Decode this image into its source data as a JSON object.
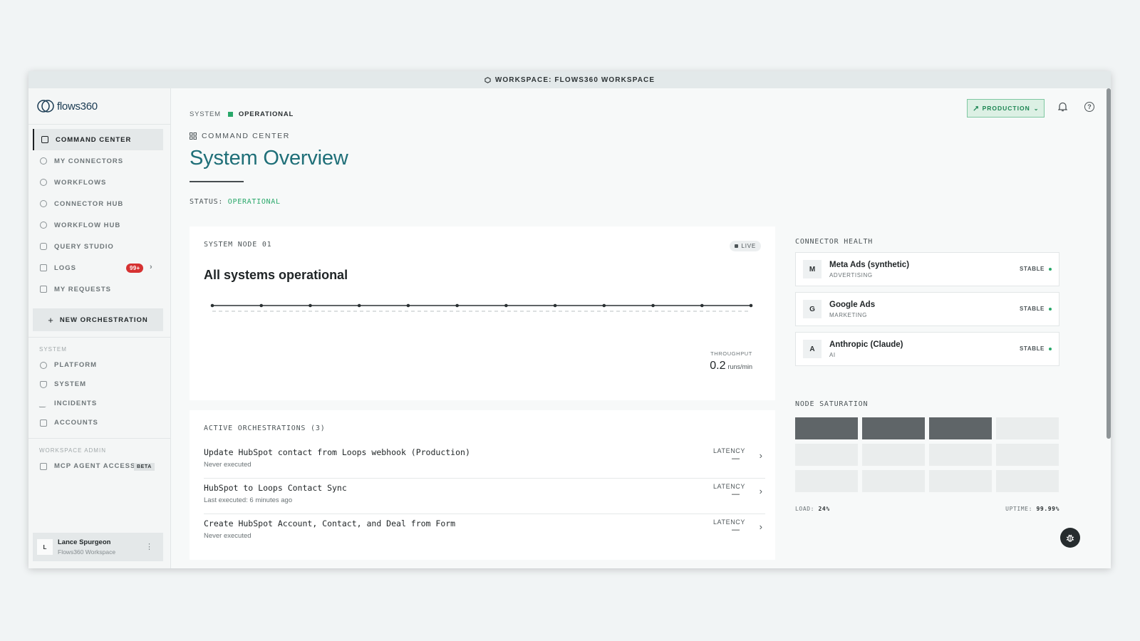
{
  "window": {
    "workspace_label": "WORKSPACE: FLOWS360 WORKSPACE"
  },
  "sidebar": {
    "logo_text": "flows360",
    "items": [
      {
        "label": "COMMAND CENTER",
        "icon": "grid-icon",
        "active": true
      },
      {
        "label": "MY CONNECTORS",
        "icon": "plug-icon"
      },
      {
        "label": "WORKFLOWS",
        "icon": "workflow-icon"
      },
      {
        "label": "CONNECTOR HUB",
        "icon": "hub-icon"
      },
      {
        "label": "WORKFLOW HUB",
        "icon": "workflow-icon"
      },
      {
        "label": "QUERY STUDIO",
        "icon": "database-icon"
      },
      {
        "label": "LOGS",
        "icon": "log-icon",
        "badge": "99+"
      },
      {
        "label": "MY REQUESTS",
        "icon": "inbox-icon"
      }
    ],
    "new_button": "NEW ORCHESTRATION",
    "system_section": "SYSTEM",
    "system_items": [
      {
        "label": "PLATFORM",
        "icon": "globe-icon"
      },
      {
        "label": "SYSTEM",
        "icon": "shield-icon"
      },
      {
        "label": "INCIDENTS",
        "icon": "activity-icon"
      },
      {
        "label": "ACCOUNTS",
        "icon": "building-icon"
      }
    ],
    "admin_section": "WORKSPACE ADMIN",
    "admin_items": [
      {
        "label": "MCP AGENT ACCESS",
        "icon": "robot-icon",
        "badge": "BETA"
      }
    ],
    "user": {
      "initial": "L",
      "name": "Lance Spurgeon",
      "workspace": "Flows360 Workspace"
    }
  },
  "header": {
    "env_button": "PRODUCTION",
    "system_label": "SYSTEM",
    "system_status": "OPERATIONAL",
    "breadcrumb": "COMMAND CENTER",
    "title": "System Overview",
    "status_label": "STATUS:",
    "status_value": "OPERATIONAL"
  },
  "node_card": {
    "label": "SYSTEM NODE 01",
    "live": "LIVE",
    "headline": "All systems operational",
    "throughput_label": "THROUGHPUT",
    "throughput_value": "0.2",
    "throughput_unit": "runs/min"
  },
  "orchestrations": {
    "title": "ACTIVE ORCHESTRATIONS (3)",
    "latency_label": "LATENCY",
    "rows": [
      {
        "name": "Update HubSpot contact from Loops webhook (Production)",
        "sub": "Never executed",
        "latency": "—"
      },
      {
        "name": "HubSpot to Loops Contact Sync",
        "sub": "Last executed: 6 minutes ago",
        "latency": "—"
      },
      {
        "name": "Create HubSpot Account, Contact, and Deal from Form",
        "sub": "Never executed",
        "latency": "—"
      }
    ]
  },
  "connector_health": {
    "title": "CONNECTOR HEALTH",
    "items": [
      {
        "initial": "M",
        "name": "Meta Ads (synthetic)",
        "category": "ADVERTISING",
        "status": "STABLE"
      },
      {
        "initial": "G",
        "name": "Google Ads",
        "category": "MARKETING",
        "status": "STABLE"
      },
      {
        "initial": "A",
        "name": "Anthropic (Claude)",
        "category": "AI",
        "status": "STABLE"
      }
    ]
  },
  "node_saturation": {
    "title": "NODE SATURATION",
    "load_label": "LOAD:",
    "load_value": "24%",
    "uptime_label": "UPTIME:",
    "uptime_value": "99.99%",
    "active_cells": 3,
    "total_cells": 12
  },
  "colors": {
    "accent": "#1f6f78",
    "ok": "#29a86a",
    "alert": "#d63232"
  }
}
